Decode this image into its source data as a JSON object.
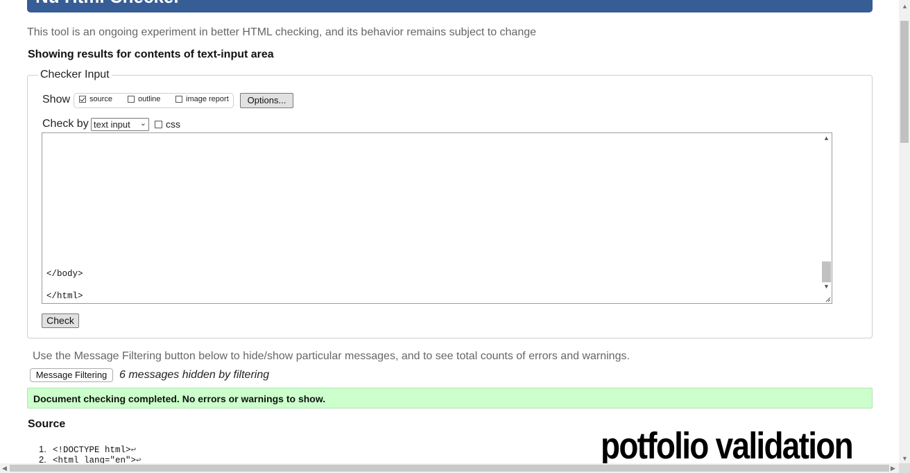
{
  "header": {
    "title": "Nu Html Checker"
  },
  "intro": "This tool is an ongoing experiment in better HTML checking, and its behavior remains subject to change",
  "results_heading": "Showing results for contents of text-input area",
  "checker": {
    "legend": "Checker Input",
    "show_label": "Show",
    "show_options": [
      {
        "label": "source",
        "checked": true
      },
      {
        "label": "outline",
        "checked": false
      },
      {
        "label": "image report",
        "checked": false
      }
    ],
    "options_button": "Options...",
    "check_by_label": "Check by",
    "check_by_value": "text input",
    "css_label": "css",
    "css_checked": false,
    "textarea_lines": [
      "</body>",
      "</html>"
    ],
    "check_button": "Check"
  },
  "filter": {
    "info": "Use the Message Filtering button below to hide/show particular messages, and to see total counts of errors and warnings.",
    "button": "Message Filtering",
    "hidden_message": "6 messages hidden by filtering"
  },
  "result": {
    "message": "Document checking completed. No errors or warnings to show.",
    "color": "#ccffcc"
  },
  "source": {
    "heading": "Source",
    "lines": [
      {
        "num": "1.",
        "code": "<!DOCTYPE html>",
        "eol": "↩"
      },
      {
        "num": "2.",
        "code": "<html lang=\"en\">",
        "eol": "↩"
      }
    ]
  },
  "overlay_caption": "potfolio validation",
  "colors": {
    "header": "#365d95",
    "success": "#ccffcc"
  }
}
